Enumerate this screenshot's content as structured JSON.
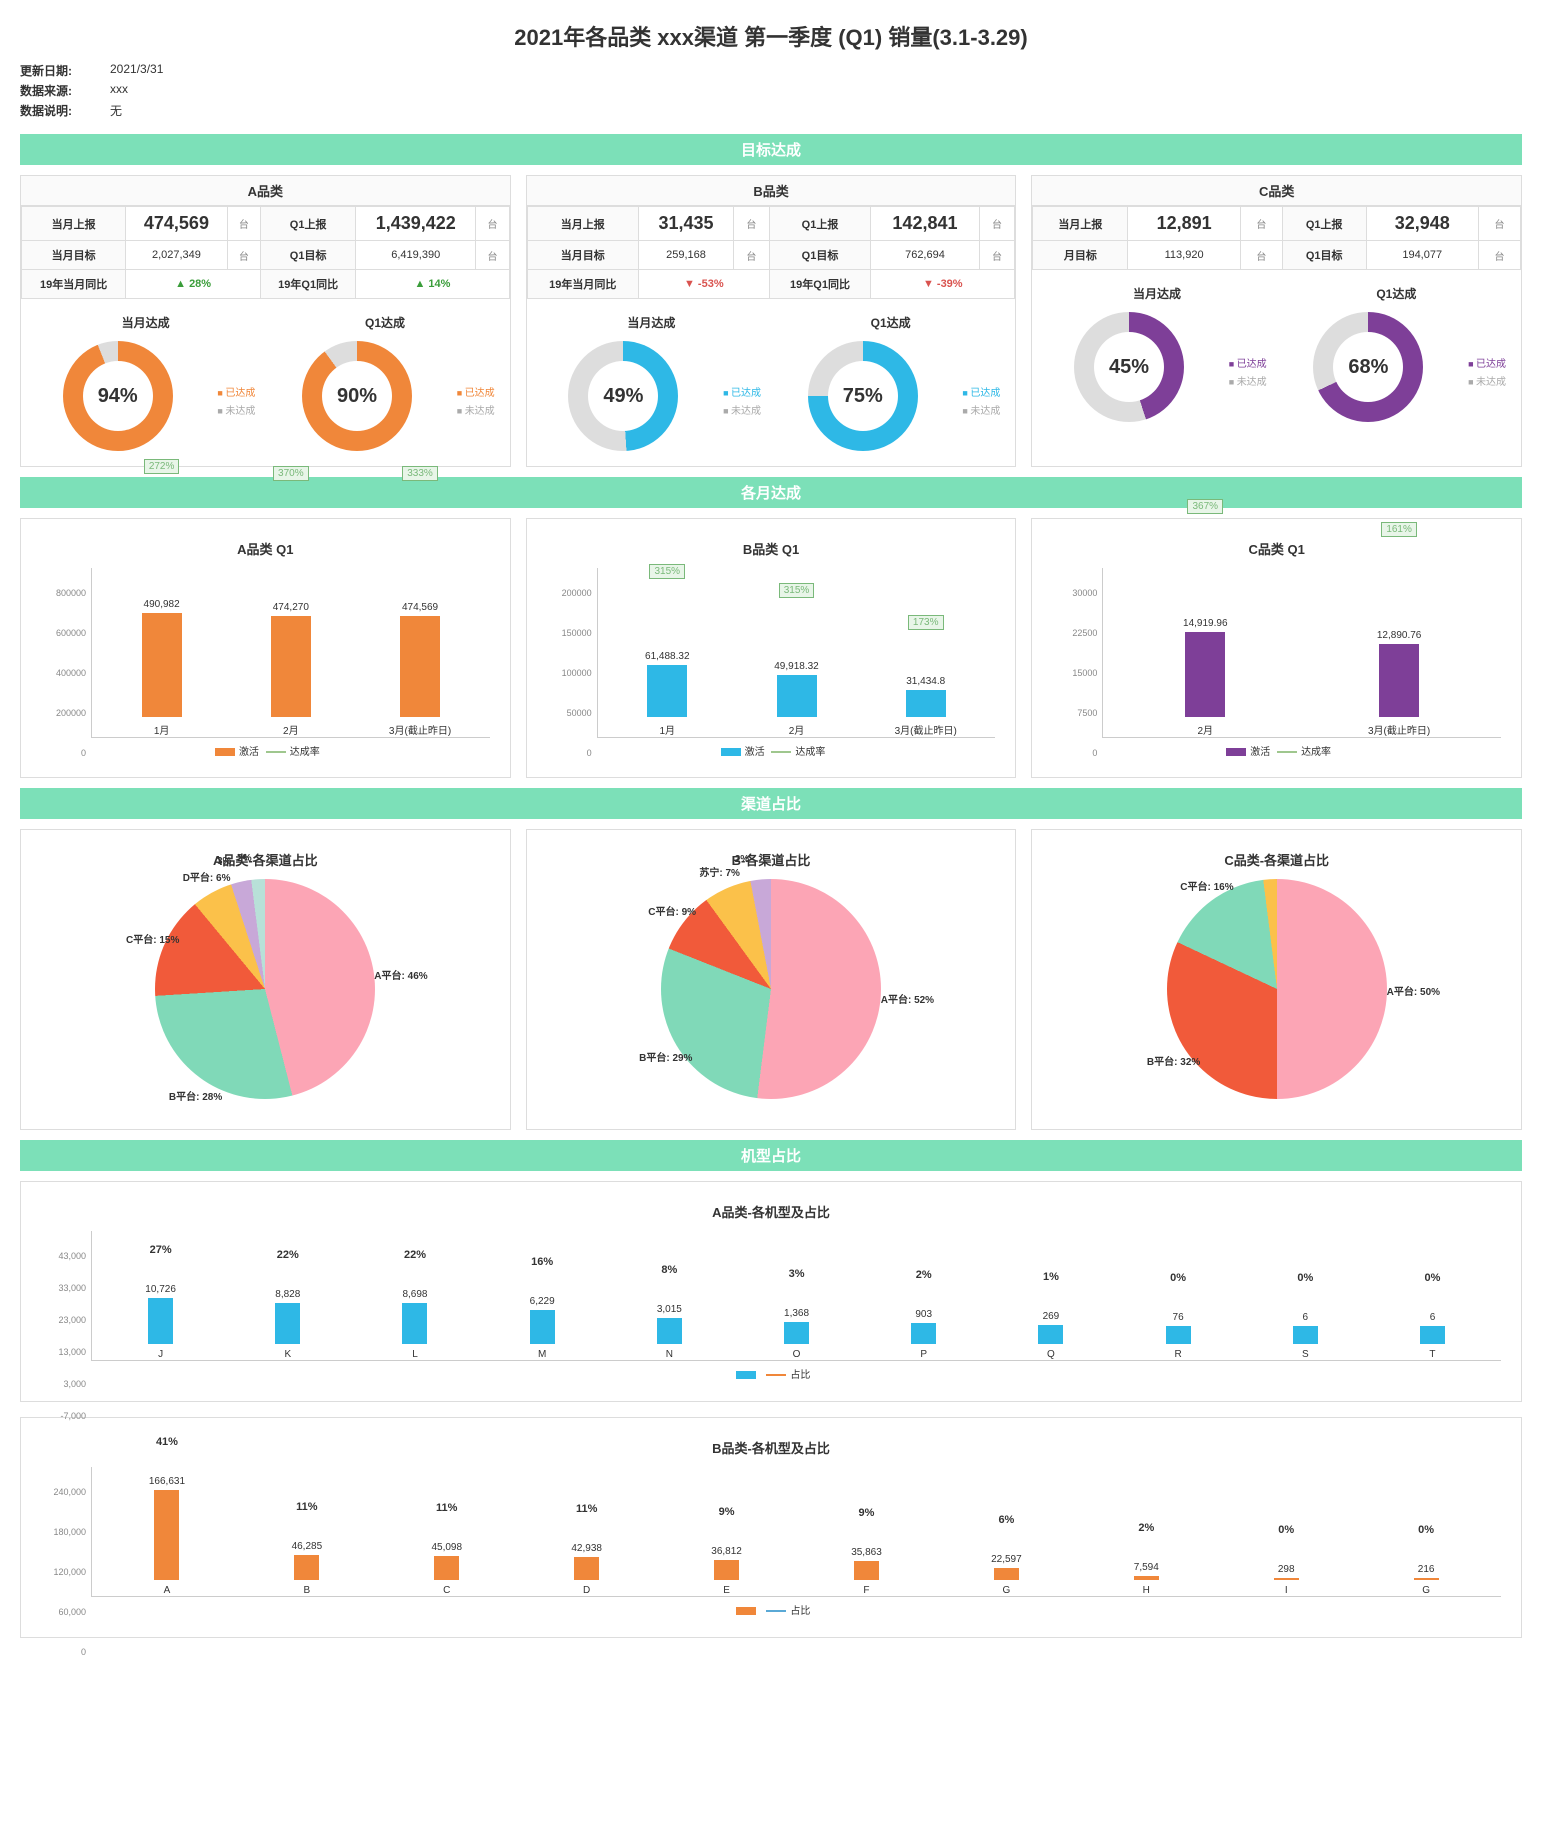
{
  "title": "2021年各品类 xxx渠道 第一季度 (Q1) 销量(3.1-3.29)",
  "meta": {
    "update_label": "更新日期:",
    "update_value": "2021/3/31",
    "source_label": "数据来源:",
    "source_value": "xxx",
    "note_label": "数据说明:",
    "note_value": "无"
  },
  "sections": {
    "s1": "目标达成",
    "s2": "各月达成",
    "s3": "渠道占比",
    "s4": "机型占比"
  },
  "kpi_labels": {
    "month_report": "当月上报",
    "month_target": "当月目标",
    "q1_report": "Q1上报",
    "q1_target": "Q1目标",
    "month_target_b": "月目标",
    "yoy_month": "19年当月同比",
    "yoy_q1": "19年Q1同比",
    "month_done": "当月达成",
    "q1_done": "Q1达成",
    "done": "已达成",
    "not_done": "未达成",
    "unit": "台",
    "legend_activate": "激活",
    "legend_rate": "达成率",
    "legend_share": "占比"
  },
  "colors": {
    "orange": "#f0873a",
    "blue": "#2eb8e6",
    "purple": "#7e3f98",
    "pink": "#fca5b5",
    "mint": "#80d9b8",
    "red": "#f15a3a",
    "yellow": "#fbc14a",
    "green_line": "#9fc78e",
    "blue_line": "#5aa9d6"
  },
  "panels": {
    "A": {
      "name": "A品类",
      "month_report": "474,569",
      "month_target": "2,027,349",
      "q1_report": "1,439,422",
      "q1_target": "6,419,390",
      "yoy_month": "28%",
      "yoy_month_dir": "up",
      "yoy_q1": "14%",
      "yoy_q1_dir": "up",
      "month_done": "94%",
      "q1_done": "90%",
      "donut_color": "#f0873a"
    },
    "B": {
      "name": "B品类",
      "month_report": "31,435",
      "month_target": "259,168",
      "q1_report": "142,841",
      "q1_target": "762,694",
      "yoy_month": "-53%",
      "yoy_month_dir": "down",
      "yoy_q1": "-39%",
      "yoy_q1_dir": "down",
      "month_done": "49%",
      "q1_done": "75%",
      "donut_color": "#2eb8e6"
    },
    "C": {
      "name": "C品类",
      "month_report": "12,891",
      "month_target": "113,920",
      "q1_report": "32,948",
      "q1_target": "194,077",
      "month_done": "45%",
      "q1_done": "68%",
      "donut_color": "#7e3f98"
    }
  },
  "chart_data": [
    {
      "id": "monthly_A",
      "type": "bar+line",
      "title": "A品类 Q1",
      "categories": [
        "1月",
        "2月",
        "3月(截止昨日)"
      ],
      "bar_series": {
        "name": "激活",
        "values": [
          490982,
          474270,
          474569
        ],
        "color": "#f0873a"
      },
      "line_series": {
        "name": "达成率",
        "values": [
          "272%",
          "370%",
          "333%"
        ],
        "color": "#9fc78e"
      },
      "ylim": [
        0,
        800000
      ]
    },
    {
      "id": "monthly_B",
      "type": "bar+line",
      "title": "B品类 Q1",
      "categories": [
        "1月",
        "2月",
        "3月(截止昨日)"
      ],
      "bar_series": {
        "name": "激活",
        "values": [
          61488.32,
          49918.32,
          31434.8
        ],
        "color": "#2eb8e6"
      },
      "line_series": {
        "name": "达成率",
        "values": [
          "315%",
          "315%",
          "173%"
        ],
        "color": "#9fc78e"
      },
      "ylim": [
        0,
        200000
      ]
    },
    {
      "id": "monthly_C",
      "type": "bar+line",
      "title": "C品类 Q1",
      "categories": [
        "2月",
        "3月(截止昨日)"
      ],
      "bar_series": {
        "name": "激活",
        "values": [
          14919.96,
          12890.76
        ],
        "color": "#7e3f98"
      },
      "line_series": {
        "name": "达成率",
        "values": [
          "367%",
          "161%"
        ],
        "color": "#9fc78e"
      },
      "ylim": [
        0,
        30000
      ]
    },
    {
      "id": "pie_A",
      "type": "pie",
      "title": "A品类-各渠道占比",
      "slices": [
        {
          "label": "A平台",
          "pct": 46,
          "color": "#fca5b5"
        },
        {
          "label": "B平台",
          "pct": 28,
          "color": "#80d9b8"
        },
        {
          "label": "C平台",
          "pct": 15,
          "color": "#f15a3a"
        },
        {
          "label": "D平台",
          "pct": 6,
          "color": "#fbc14a"
        },
        {
          "label": "",
          "pct": 3,
          "color": "#c8a8d8"
        },
        {
          "label": "",
          "pct": 2,
          "color": "#b8e0d8"
        }
      ]
    },
    {
      "id": "pie_B",
      "type": "pie",
      "title": "B-各渠道占比",
      "slices": [
        {
          "label": "A平台",
          "pct": 52,
          "color": "#fca5b5"
        },
        {
          "label": "B平台",
          "pct": 29,
          "color": "#80d9b8"
        },
        {
          "label": "C平台",
          "pct": 9,
          "color": "#f15a3a"
        },
        {
          "label": "苏宁",
          "pct": 7,
          "color": "#fbc14a"
        },
        {
          "label": "",
          "pct": 2,
          "color": "#c8a8d8"
        }
      ]
    },
    {
      "id": "pie_C",
      "type": "pie",
      "title": "C品类-各渠道占比",
      "slices": [
        {
          "label": "A平台",
          "pct": 50,
          "color": "#fca5b5"
        },
        {
          "label": "B平台",
          "pct": 32,
          "color": "#f15a3a"
        },
        {
          "label": "C平台",
          "pct": 16,
          "color": "#80d9b8"
        },
        {
          "label": "",
          "pct": 1,
          "color": "#fbc14a"
        }
      ]
    },
    {
      "id": "model_A",
      "type": "bar+line",
      "title": "A品类-各机型及占比",
      "categories": [
        "J",
        "K",
        "L",
        "M",
        "N",
        "O",
        "P",
        "Q",
        "R",
        "S",
        "T"
      ],
      "bar_series": {
        "name": "激活",
        "values": [
          10726,
          8828,
          8698,
          6229,
          3015,
          1368,
          903,
          269,
          76,
          6,
          6
        ],
        "color": "#2eb8e6"
      },
      "line_series": {
        "name": "占比",
        "values": [
          "27%",
          "22%",
          "22%",
          "16%",
          "8%",
          "3%",
          "2%",
          "1%",
          "0%",
          "0%",
          "0%"
        ],
        "color": "#f0873a"
      },
      "ylim": [
        -7000,
        43000
      ]
    },
    {
      "id": "model_B",
      "type": "bar+line",
      "title": "B品类-各机型及占比",
      "categories": [
        "A",
        "B",
        "C",
        "D",
        "E",
        "F",
        "G",
        "H",
        "I",
        "G"
      ],
      "bar_series": {
        "name": "激活",
        "values": [
          166631,
          46285,
          45098,
          42938,
          36812,
          35863,
          22597,
          7594,
          298,
          216
        ],
        "color": "#f0873a"
      },
      "line_series": {
        "name": "占比",
        "values": [
          "41%",
          "11%",
          "11%",
          "11%",
          "9%",
          "9%",
          "6%",
          "2%",
          "0%",
          "0%"
        ],
        "color": "#5aa9d6"
      },
      "ylim": [
        0,
        240000
      ]
    }
  ]
}
